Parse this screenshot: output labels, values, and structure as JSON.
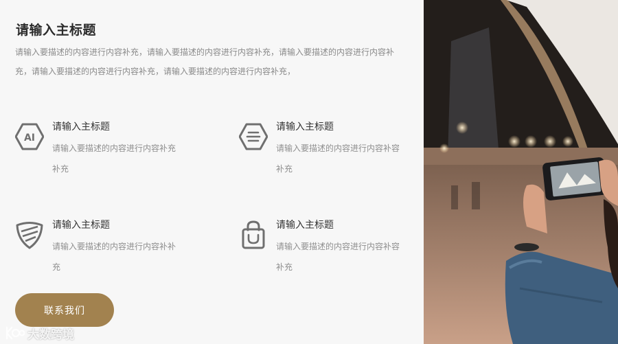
{
  "header": {
    "title": "请输入主标题",
    "description": "请输入要描述的内容进行内容补充，请输入要描述的内容进行内容补充，请输入要描述的内容进行内容补充，请输入要描述的内容进行内容补充，请输入要描述的内容进行内容补充，"
  },
  "features": [
    {
      "icon": "ai-hexagon-icon",
      "title": "请输入主标题",
      "description": "请输入要描述的内容进行内容补充补充"
    },
    {
      "icon": "menu-hexagon-icon",
      "title": "请输入主标题",
      "description": "请输入要描述的内容进行内容补容补充"
    },
    {
      "icon": "shield-icon",
      "title": "请输入主标题",
      "description": "请输入要描述的内容进行内容补补充"
    },
    {
      "icon": "shopping-bag-icon",
      "title": "请输入主标题",
      "description": "请输入要描述的内容进行内容补容补充"
    }
  ],
  "cta": {
    "label": "联系我们"
  },
  "watermark": {
    "text": "大数跨境"
  },
  "colors": {
    "accent": "#a2824f",
    "background": "#f7f7f7",
    "title": "#2b2b2b",
    "body_text": "#8a8a8a",
    "icon": "#6f6f6f"
  }
}
